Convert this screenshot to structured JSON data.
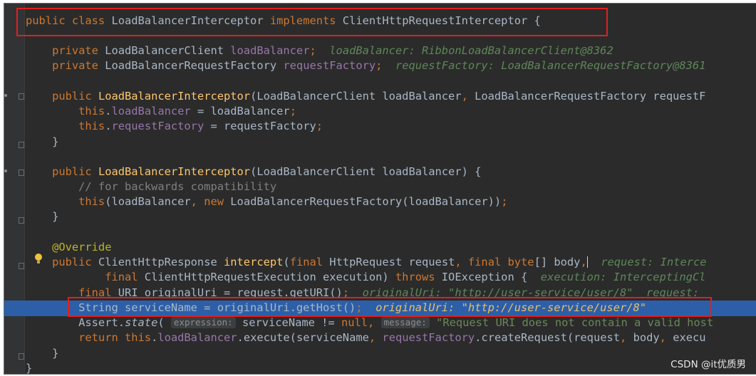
{
  "editor": {
    "code_lines": [
      {
        "parts": [
          {
            "t": "public class ",
            "c": "k"
          },
          {
            "t": "LoadBalancerInterceptor "
          },
          {
            "t": "implements ",
            "c": "k"
          },
          {
            "t": "ClientHttpRequestInterceptor {"
          }
        ]
      },
      {
        "parts": [
          {
            "t": "    private ",
            "c": "k"
          },
          {
            "t": "LoadBalancerClient "
          },
          {
            "t": "loadBalancer",
            "c": "f"
          },
          {
            "t": ";",
            "c": "k"
          },
          {
            "t": "  loadBalancer: RibbonLoadBalancerClient@8362",
            "c": "inl"
          }
        ]
      },
      {
        "parts": [
          {
            "t": "    private ",
            "c": "k"
          },
          {
            "t": "LoadBalancerRequestFactory "
          },
          {
            "t": "requestFactory",
            "c": "f"
          },
          {
            "t": ";",
            "c": "k"
          },
          {
            "t": "  requestFactory: LoadBalancerRequestFactory@8361",
            "c": "inl"
          }
        ]
      },
      {
        "parts": [
          {
            "t": "    public ",
            "c": "k"
          },
          {
            "t": "LoadBalancerInterceptor",
            "c": "m"
          },
          {
            "t": "(LoadBalancerClient loadBalancer"
          },
          {
            "t": ", ",
            "c": "k"
          },
          {
            "t": "LoadBalancerRequestFactory requestF"
          }
        ]
      },
      {
        "parts": [
          {
            "t": "        this",
            "c": "k"
          },
          {
            "t": "."
          },
          {
            "t": "loadBalancer",
            "c": "f"
          },
          {
            "t": " = loadBalancer"
          },
          {
            "t": ";",
            "c": "k"
          }
        ]
      },
      {
        "parts": [
          {
            "t": "        this",
            "c": "k"
          },
          {
            "t": "."
          },
          {
            "t": "requestFactory",
            "c": "f"
          },
          {
            "t": " = requestFactory"
          },
          {
            "t": ";",
            "c": "k"
          }
        ]
      },
      {
        "parts": [
          {
            "t": "    }"
          }
        ]
      },
      {
        "parts": [
          {
            "t": "    public ",
            "c": "k"
          },
          {
            "t": "LoadBalancerInterceptor",
            "c": "m"
          },
          {
            "t": "(LoadBalancerClient loadBalancer) {"
          }
        ]
      },
      {
        "parts": [
          {
            "t": "        // for backwards compatibility",
            "c": "c"
          }
        ]
      },
      {
        "parts": [
          {
            "t": "        this",
            "c": "k"
          },
          {
            "t": "(loadBalancer"
          },
          {
            "t": ", new ",
            "c": "k"
          },
          {
            "t": "LoadBalancerRequestFactory(loadBalancer))"
          },
          {
            "t": ";",
            "c": "k"
          }
        ]
      },
      {
        "parts": [
          {
            "t": "    }"
          }
        ]
      },
      {
        "parts": [
          {
            "t": "    @Override",
            "c": "a"
          }
        ]
      },
      {
        "parts": [
          {
            "t": "    public ",
            "c": "k"
          },
          {
            "t": "ClientHttpResponse "
          },
          {
            "t": "intercept",
            "c": "m"
          },
          {
            "t": "("
          },
          {
            "t": "final ",
            "c": "k"
          },
          {
            "t": "HttpRequest request"
          },
          {
            "t": ", final byte",
            "c": "k"
          },
          {
            "t": "[] body"
          },
          {
            "t": ",",
            "c": "k"
          },
          {
            "caret": true
          },
          {
            "t": "  request: Interce",
            "c": "inl"
          }
        ]
      },
      {
        "parts": [
          {
            "t": "            final ",
            "c": "k"
          },
          {
            "t": "ClientHttpRequestExecution execution) "
          },
          {
            "t": "throws ",
            "c": "k"
          },
          {
            "t": "IOException {  "
          },
          {
            "t": "execution: InterceptingCl",
            "c": "inl"
          }
        ]
      },
      {
        "parts": [
          {
            "t": "        final ",
            "c": "k"
          },
          {
            "t": "URI originalUri = request.getURI()"
          },
          {
            "t": ";",
            "c": "k"
          },
          {
            "t": "  originalUri: \"http://user-service/user/8\"  request: ",
            "c": "inl"
          }
        ]
      },
      {
        "parts": [
          {
            "t": "        String serviceName = originalUri.getHost()"
          },
          {
            "t": ";",
            "c": "k"
          },
          {
            "t": "  originalUri: \"http://user-service/user/8\"",
            "c": "inl-hot"
          }
        ]
      },
      {
        "parts": [
          {
            "t": "        Assert."
          },
          {
            "t": "state",
            "c": "i"
          },
          {
            "t": "( "
          },
          {
            "hint": "expression:"
          },
          {
            "t": " serviceName != "
          },
          {
            "t": "null, ",
            "c": "k"
          },
          {
            "hint": "message:"
          },
          {
            "t": " \"Request URI does not contain a valid host",
            "c": "s"
          }
        ]
      },
      {
        "parts": [
          {
            "t": "        return this",
            "c": "k"
          },
          {
            "t": "."
          },
          {
            "t": "loadBalancer",
            "c": "f"
          },
          {
            "t": ".execute(serviceName"
          },
          {
            "t": ", ",
            "c": "k"
          },
          {
            "t": "requestFactory",
            "c": "f"
          },
          {
            "t": ".createRequest(request"
          },
          {
            "t": ", ",
            "c": "k"
          },
          {
            "t": "body"
          },
          {
            "t": ", ",
            "c": "k"
          },
          {
            "t": "execu"
          }
        ]
      },
      {
        "parts": [
          {
            "t": "    }"
          }
        ]
      },
      {
        "parts": [
          {
            "t": "}"
          }
        ]
      }
    ]
  },
  "watermark": "CSDN @it优质男",
  "colors": {
    "editor_bg": "#2b2b2b",
    "keyword": "#cc7832",
    "field": "#9876aa",
    "method": "#ffc66d",
    "comment": "#808080",
    "annotation": "#bbb529",
    "string": "#6a8759",
    "inline_value": "#5e8759",
    "execution_line_bg": "#2d5fa8",
    "callout_box": "#e02020"
  }
}
